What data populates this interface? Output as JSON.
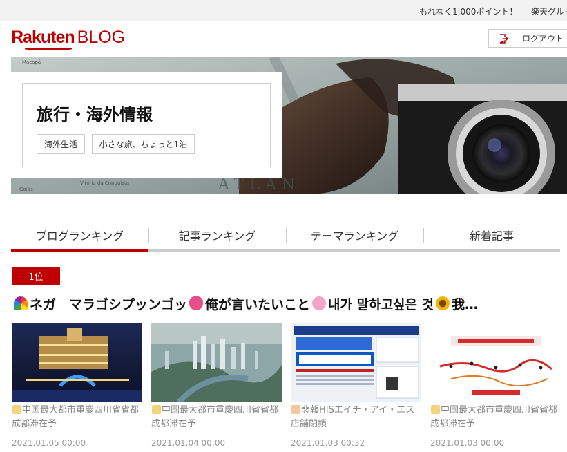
{
  "topbar": {
    "promo": "もれなく1,000ポイント！",
    "group": "楽天グル−"
  },
  "header": {
    "logo_main": "Rakuten",
    "logo_sub": "BLOG",
    "logout_label": "ログアウト",
    "logout_icon": "logout-icon"
  },
  "blog": {
    "title": "旅行・海外情報",
    "tags": [
      "海外生活",
      "小さな旅、ちょっと1泊"
    ]
  },
  "tabs": [
    {
      "label": "ブログランキング",
      "active": true
    },
    {
      "label": "記事ランキング",
      "active": false
    },
    {
      "label": "テーマランキング",
      "active": false
    },
    {
      "label": "新着記事",
      "active": false
    }
  ],
  "ranking": {
    "rank_label": "1位",
    "blog_title_parts": [
      "ネガ　マラゴシプッンゴッ",
      "俺が言いたいこと",
      "내가 말하고싶은 것",
      "我…"
    ]
  },
  "articles": [
    {
      "title": "中国最大都市重慶四川省省都成都滞在予",
      "date": "2021.01.05 00:00"
    },
    {
      "title": "中国最大都市重慶四川省省都成都滞在予",
      "date": "2021.01.04 00:00"
    },
    {
      "title": "悲報HISエイチ・アイ・エス店舗閉鎖",
      "date": "2021.01.03 00:32"
    },
    {
      "title": "中国最大都市重慶四川省省都成都滞在予",
      "date": "2021.01.03 00:00"
    }
  ],
  "colors": {
    "brand_red": "#bf0000",
    "tab_line": "#cccccc",
    "muted_text": "#888888"
  }
}
